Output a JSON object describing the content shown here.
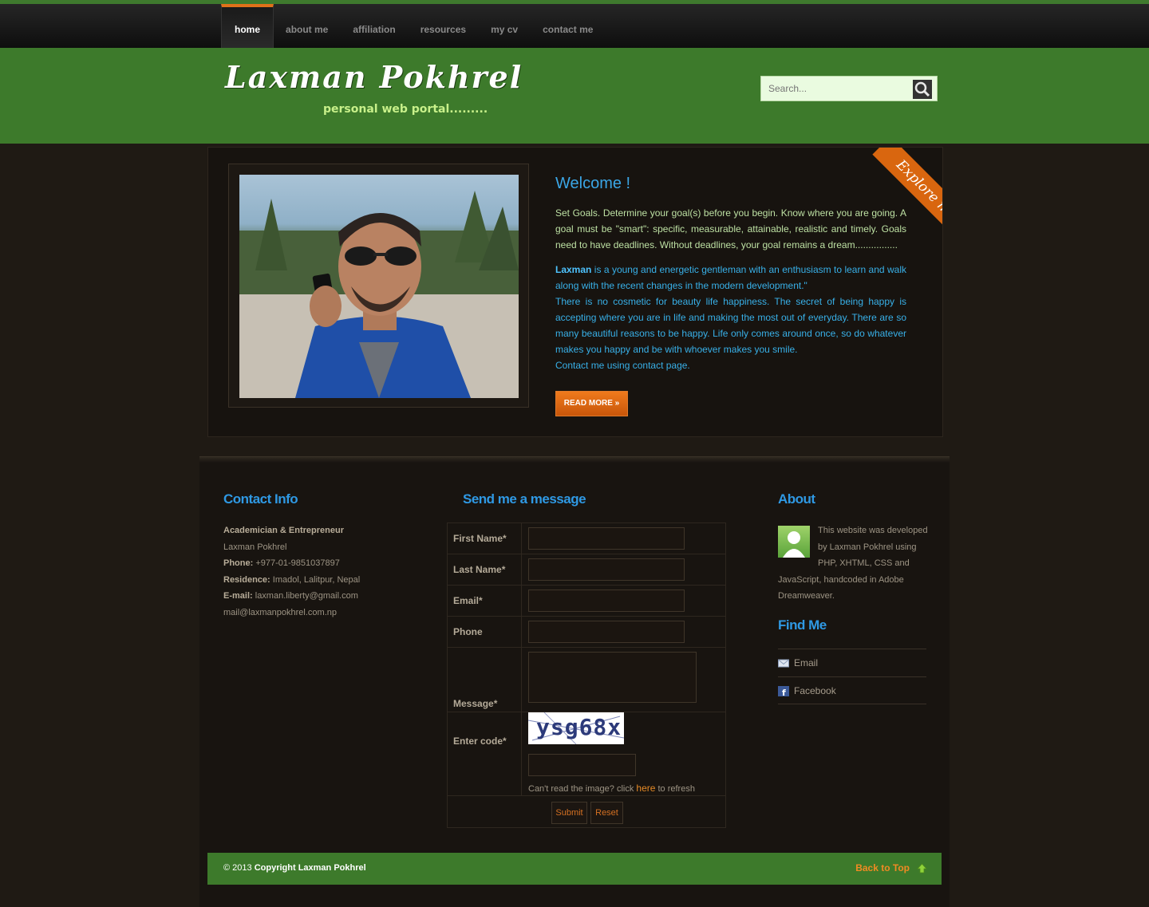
{
  "nav": {
    "items": [
      "home",
      "about me",
      "affiliation",
      "resources",
      "my cv",
      "contact me"
    ]
  },
  "header": {
    "title": "Laxman Pokhrel",
    "subtitle": "personal web portal.........",
    "search_placeholder": "Search..."
  },
  "feature": {
    "ribbon": "Explore me..",
    "heading": "Welcome !",
    "para1": "Set Goals. Determine your goal(s) before you begin. Know where you are going. A goal must be \"smart\": specific, measurable, attainable, realistic and timely. Goals need to have deadlines. Without deadlines, your goal remains a dream................",
    "name": "Laxman",
    "para2a": " is a young and energetic gentleman with an enthusiasm to learn and walk along with the recent changes in the modern development.\"",
    "para2b": "There is no cosmetic for beauty life happiness. The secret of being happy is accepting where you are in life and making the most out of everyday. There are so many beautiful reasons to be happy. Life only comes around once, so do whatever makes you happy and be with whoever makes you smile.",
    "para2c": "Contact me using contact page.",
    "readmore": "READ MORE »"
  },
  "contact_info": {
    "heading": "Contact Info",
    "role": "Academician & Entrepreneur",
    "name": "Laxman Pokhrel",
    "phone_label": "Phone:",
    "phone": "+977-01-9851037897",
    "residence_label": "Residence:",
    "residence": "Imadol, Lalitpur, Nepal",
    "email_label": "E-mail:",
    "email1": "laxman.liberty@gmail.com",
    "email2": "mail@laxmanpokhrel.com.np"
  },
  "form": {
    "heading": "Send me a message",
    "labels": [
      "First Name*",
      "Last Name*",
      "Email*",
      "Phone",
      "Message*",
      "Enter code*"
    ],
    "captcha_text": "ysg68x",
    "refresh_pre": "Can't read the image? click ",
    "refresh_link": "here",
    "refresh_post": " to refresh",
    "submit": "Submit",
    "reset": "Reset"
  },
  "about": {
    "heading": "About",
    "text": "This website was developed by Laxman Pokhrel using PHP, XHTML, CSS and JavaScript, handcoded in Adobe Dreamweaver."
  },
  "findme": {
    "heading": "Find Me",
    "items": [
      {
        "label": "Email",
        "icon": "envelope-icon"
      },
      {
        "label": "Facebook",
        "icon": "facebook-icon"
      }
    ]
  },
  "footer": {
    "year": "© 2013 ",
    "copyright": "Copyright Laxman Pokhrel",
    "backtop": "Back to Top"
  },
  "colors": {
    "green": "#3d7a2b",
    "accent_orange": "#e0711a",
    "heading_blue": "#2f99e4"
  }
}
